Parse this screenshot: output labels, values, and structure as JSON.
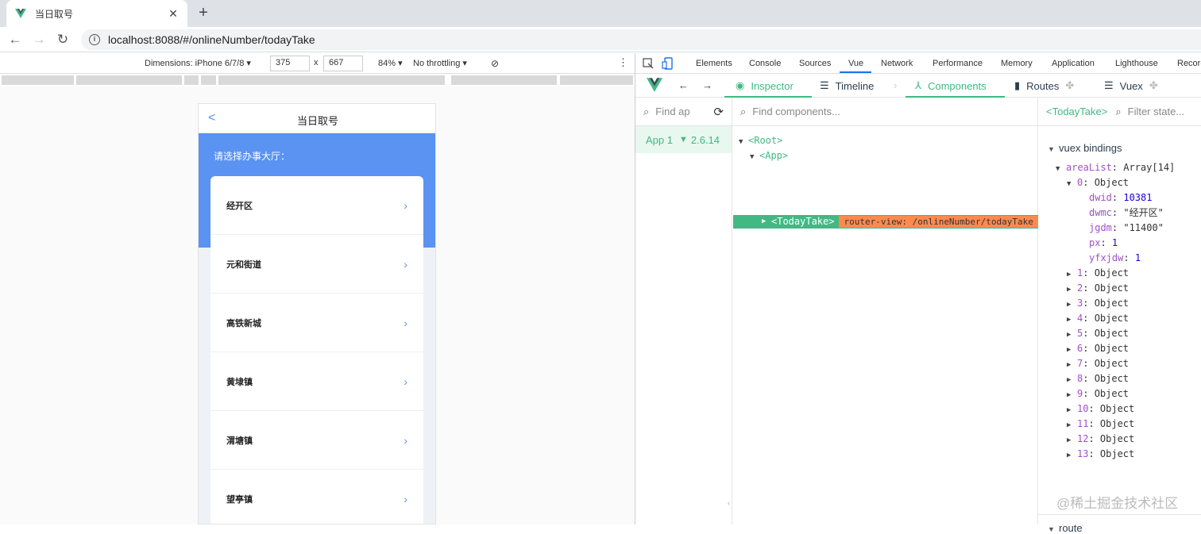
{
  "browser": {
    "tab_title": "当日取号",
    "tab_close": "✕",
    "new_tab": "+",
    "url": "localhost:8088/#/onlineNumber/todayTake"
  },
  "device_toolbar": {
    "dimensions_label": "Dimensions: iPhone 6/7/8 ▾",
    "width": "375",
    "times": "x",
    "height": "667",
    "zoom": "84% ▾",
    "throttling": "No throttling ▾"
  },
  "phone": {
    "back": "<",
    "title": "当日取号",
    "hint": "请选择办事大厅：",
    "halls": [
      "经开区",
      "元和街道",
      "高铁新城",
      "黄埭镇",
      "渭塘镇",
      "望亭镇"
    ],
    "chevron": "›"
  },
  "devtools": {
    "tabs": [
      "Elements",
      "Console",
      "Sources",
      "Vue",
      "Network",
      "Performance",
      "Memory",
      "Application",
      "Lighthouse",
      "Record"
    ],
    "active_tab": "Vue"
  },
  "vue_bar": {
    "inspector": "Inspector",
    "timeline": "Timeline",
    "components": "Components",
    "routes": "Routes",
    "vuex": "Vuex"
  },
  "apps": {
    "find_placeholder": "Find ap",
    "app_name": "App 1",
    "vue_version": "2.6.14"
  },
  "tree": {
    "find_placeholder": "Find components...",
    "root": "<Root>",
    "app": "<App>",
    "selected": "<TodayTake>",
    "router_badge": "router-view: /onlineNumber/todayTake"
  },
  "state": {
    "component": "<TodayTake>",
    "filter_placeholder": "Filter state...",
    "vuex_bindings": "vuex bindings",
    "areaList_key": "areaList",
    "areaList_value": "Array[14]",
    "item0_key": "0",
    "item0_value": "Object",
    "fields": [
      {
        "key": "dwid",
        "value": "10381",
        "type": "num"
      },
      {
        "key": "dwmc",
        "value": "\"经开区\"",
        "type": "str"
      },
      {
        "key": "jgdm",
        "value": "\"11400\"",
        "type": "str"
      },
      {
        "key": "px",
        "value": "1",
        "type": "num"
      },
      {
        "key": "yfxjdw",
        "value": "1",
        "type": "num"
      }
    ],
    "items": [
      "1",
      "2",
      "3",
      "4",
      "5",
      "6",
      "7",
      "8",
      "9",
      "10",
      "11",
      "12",
      "13"
    ],
    "object_label": "Object",
    "route": "route"
  },
  "watermark": "@稀土掘金技术社区"
}
